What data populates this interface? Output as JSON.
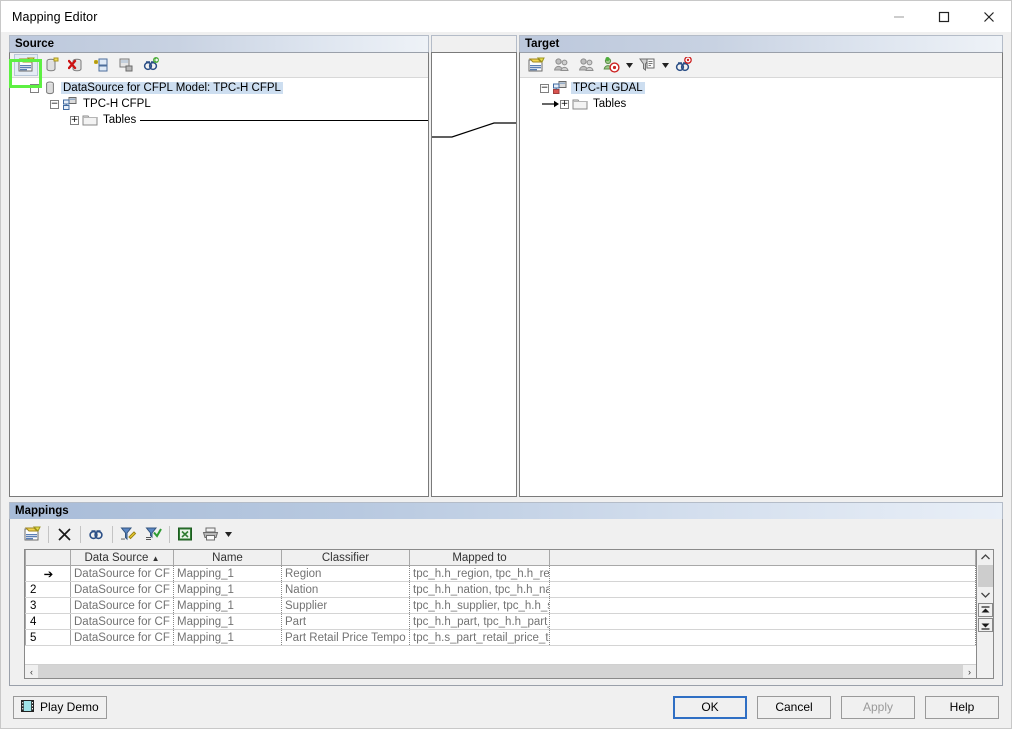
{
  "window": {
    "title": "Mapping Editor",
    "minimize_label": "Minimize",
    "maximize_label": "Maximize",
    "close_label": "Close"
  },
  "source_panel": {
    "header": "Source",
    "toolbar": [
      {
        "name": "properties-icon",
        "tooltip": "Properties"
      },
      {
        "name": "datasource-icon",
        "tooltip": "Data Source"
      },
      {
        "name": "delete-datasource-icon",
        "tooltip": "Delete Data Source"
      },
      {
        "name": "add-model-icon",
        "tooltip": "Add Model"
      },
      {
        "name": "import-model-icon",
        "tooltip": "Import Model"
      },
      {
        "name": "find-icon",
        "tooltip": "Find"
      }
    ],
    "tree": [
      {
        "label": "DataSource for CFPL Model: TPC-H CFPL",
        "icon": "datasource-icon",
        "expander": "-",
        "selected": true,
        "depth": 0
      },
      {
        "label": "TPC-H CFPL",
        "icon": "model-icon",
        "expander": "-",
        "selected": false,
        "depth": 1
      },
      {
        "label": "Tables",
        "icon": "folder-icon",
        "expander": "+",
        "selected": false,
        "depth": 2
      }
    ]
  },
  "target_panel": {
    "header": "Target",
    "toolbar": [
      {
        "name": "properties-icon",
        "tooltip": "Properties"
      },
      {
        "name": "group-icon",
        "tooltip": "Group"
      },
      {
        "name": "ungroup-icon",
        "tooltip": "Ungroup"
      },
      {
        "name": "automap-icon",
        "tooltip": "Auto Map"
      },
      {
        "name": "filter-icon",
        "tooltip": "Filter"
      },
      {
        "name": "find-target-icon",
        "tooltip": "Find Target"
      }
    ],
    "tree": [
      {
        "label": "TPC-H GDAL",
        "icon": "model-icon",
        "expander": "-",
        "selected": true,
        "depth": 0
      },
      {
        "label": "Tables",
        "icon": "folder-icon",
        "expander": "+",
        "selected": false,
        "depth": 1
      }
    ]
  },
  "mappings_panel": {
    "header": "Mappings",
    "toolbar": [
      {
        "name": "properties-icon",
        "tooltip": "Properties"
      },
      {
        "name": "delete-icon",
        "tooltip": "Delete"
      },
      {
        "name": "find-icon",
        "tooltip": "Find"
      },
      {
        "name": "edit-filter-icon",
        "tooltip": "Edit Filter"
      },
      {
        "name": "apply-filter-icon",
        "tooltip": "Apply Filter"
      },
      {
        "name": "export-excel-icon",
        "tooltip": "Export to Excel"
      },
      {
        "name": "print-icon",
        "tooltip": "Print"
      }
    ],
    "columns": [
      "",
      "Data Source",
      "Name",
      "Classifier",
      "Mapped to",
      ""
    ],
    "sorted_column": "Data Source",
    "sort_direction": "asc",
    "rows": [
      {
        "num": "➔",
        "current": true,
        "data_source": "DataSource for CF",
        "name": "Mapping_1",
        "classifier": "Region",
        "mapped_to": "tpc_h.h_region, tpc_h.h_reg"
      },
      {
        "num": "2",
        "current": false,
        "data_source": "DataSource for CF",
        "name": "Mapping_1",
        "classifier": "Nation",
        "mapped_to": "tpc_h.h_nation, tpc_h.h_nat"
      },
      {
        "num": "3",
        "current": false,
        "data_source": "DataSource for CF",
        "name": "Mapping_1",
        "classifier": "Supplier",
        "mapped_to": "tpc_h.h_supplier, tpc_h.h_s"
      },
      {
        "num": "4",
        "current": false,
        "data_source": "DataSource for CF",
        "name": "Mapping_1",
        "classifier": "Part",
        "mapped_to": "tpc_h.h_part, tpc_h.h_part_"
      },
      {
        "num": "5",
        "current": false,
        "data_source": "DataSource for CF",
        "name": "Mapping_1",
        "classifier": "Part Retail Price Tempo",
        "mapped_to": "tpc_h.s_part_retail_price_te"
      }
    ],
    "hscroll_left_glyph": "‹",
    "hscroll_right_glyph": "›",
    "vscroll_up_glyph": "⌃",
    "vscroll_down_glyph": "⌄",
    "vscroll_top_glyph": "⤒",
    "vscroll_bottom_glyph": "⤓"
  },
  "footer": {
    "play_demo": "Play Demo",
    "ok": "OK",
    "cancel": "Cancel",
    "apply": "Apply",
    "help": "Help",
    "apply_disabled": true
  },
  "annotation": {
    "highlight_target": "source-toolbar-properties-button",
    "highlight_color": "#5df042"
  }
}
